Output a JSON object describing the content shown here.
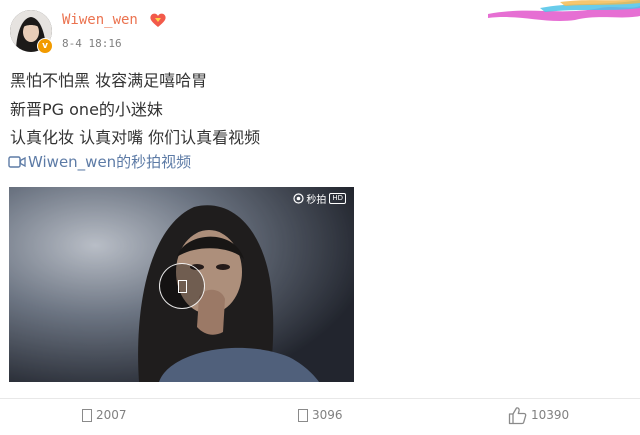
{
  "post": {
    "username": "Wiwen_wen",
    "time": "8-4 18:16",
    "verified_badge": "v",
    "lines": [
      "黑怕不怕黑 妆容满足嘻哈胃",
      "新晋PG one的小迷妹",
      "认真化妆 认真对嘴 你们认真看视频"
    ],
    "video_link": "Wiwen_wen的秒拍视频",
    "video": {
      "watermark": "秒拍",
      "hd": "HD"
    }
  },
  "actions": {
    "forward_count": "2007",
    "comment_count": "3096",
    "like_count": "10390"
  },
  "colors": {
    "username": "#eb7350",
    "link": "#5d7ba6",
    "muted": "#808080",
    "text": "#333333"
  },
  "icons": [
    "avatar",
    "heart-badge-icon",
    "verified-icon",
    "video-link-icon",
    "play-icon",
    "forward-icon",
    "comment-icon",
    "like-icon"
  ]
}
